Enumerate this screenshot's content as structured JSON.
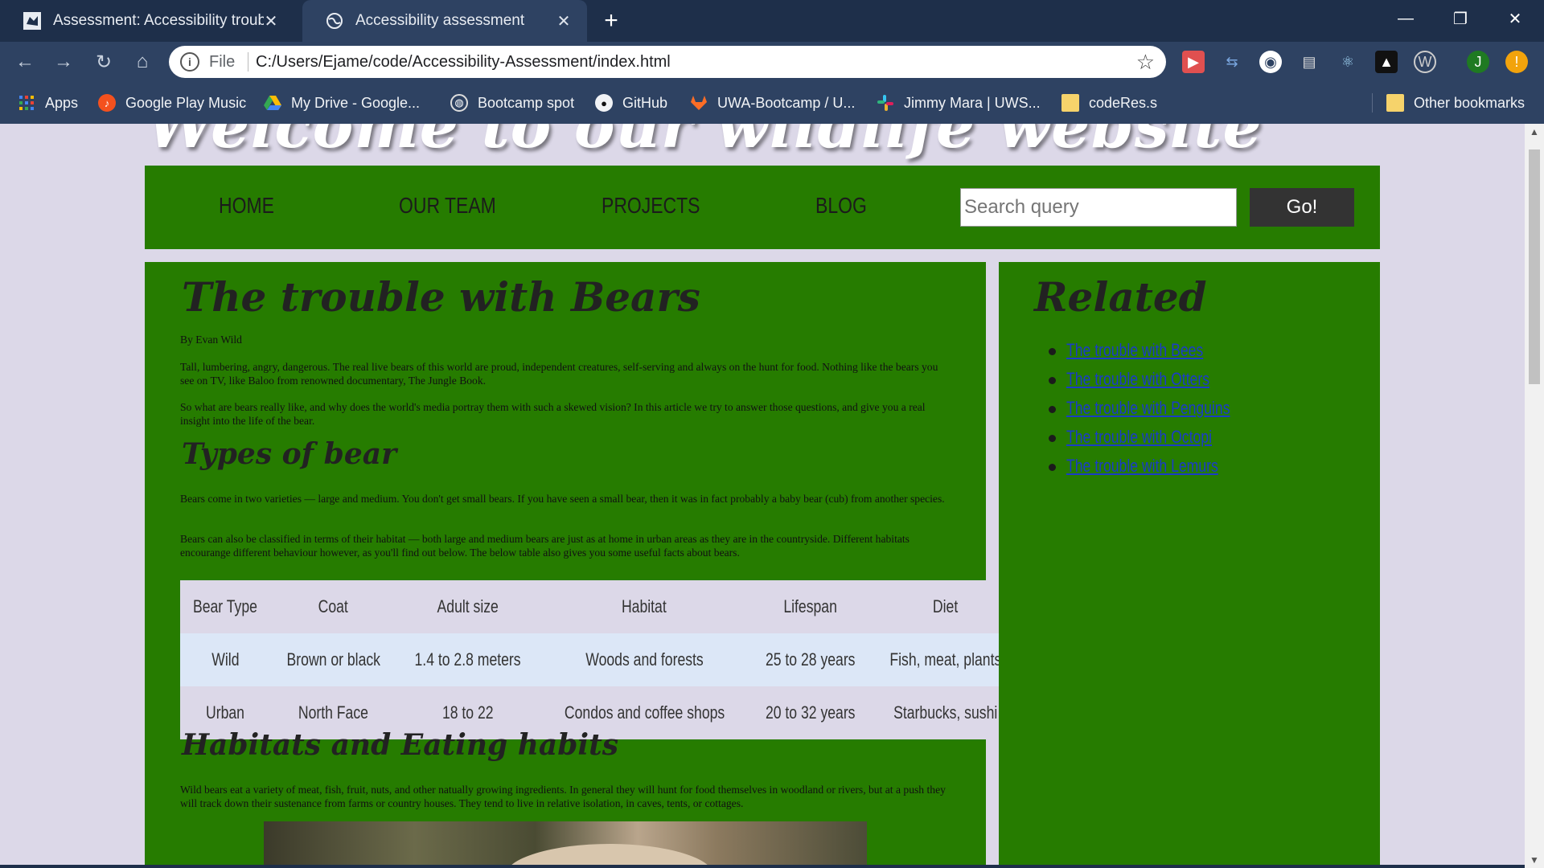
{
  "browser": {
    "tabs": [
      {
        "title": "Assessment: Accessibility troubleshooting"
      },
      {
        "title": "Accessibility assessment"
      }
    ],
    "omnibox": {
      "scheme": "File",
      "url": "C:/Users/Ejame/code/Accessibility-Assessment/index.html"
    },
    "profile_initial": "J",
    "bookmarks": [
      {
        "label": "Apps",
        "icon": "apps-grid-icon"
      },
      {
        "label": "Google Play Music",
        "icon": "play-music-icon"
      },
      {
        "label": "My Drive - Google...",
        "icon": "google-drive-icon"
      },
      {
        "label": "Bootcamp spot",
        "icon": "globe-icon"
      },
      {
        "label": "GitHub",
        "icon": "github-icon"
      },
      {
        "label": "UWA-Bootcamp / U...",
        "icon": "gitlab-icon"
      },
      {
        "label": "Jimmy Mara | UWS...",
        "icon": "slack-icon"
      },
      {
        "label": "codeRes.s",
        "icon": "folder-icon"
      }
    ],
    "other_bookmarks": "Other bookmarks"
  },
  "site": {
    "title": "Welcome to our wildlife website",
    "nav": [
      "HOME",
      "OUR TEAM",
      "PROJECTS",
      "BLOG"
    ],
    "search_placeholder": "Search query",
    "search_button": "Go!"
  },
  "article": {
    "heading": "The trouble with Bears",
    "byline": "By Evan Wild",
    "intro_1": "Tall, lumbering, angry, dangerous. The real live bears of this world are proud, independent creatures, self-serving and always on the hunt for food. Nothing like the bears you see on TV, like Baloo from renowned documentary, The Jungle Book.",
    "intro_2": "So what are bears really like, and why does the world's media portray them with such a skewed vision? In this article we try to answer those questions, and give you a real insight into the life of the bear.",
    "types_heading": "Types of bear",
    "types_1": "Bears come in two varieties — large and medium. You don't get small bears. If you have seen a small bear, then it was in fact probably a baby bear (cub) from another species.",
    "types_2": "Bears can also be classified in terms of their habitat — both large and medium bears are just as at home in urban areas as they are in the countryside. Different habitats encourange different behaviour however, as you'll find out below. The below table also gives you some useful facts about bears.",
    "table": {
      "headers": [
        "Bear Type",
        "Coat",
        "Adult size",
        "Habitat",
        "Lifespan",
        "Diet"
      ],
      "rows": [
        [
          "Wild",
          "Brown or black",
          "1.4 to 2.8 meters",
          "Woods and forests",
          "25 to 28 years",
          "Fish, meat, plants"
        ],
        [
          "Urban",
          "North Face",
          "18 to 22",
          "Condos and coffee shops",
          "20 to 32 years",
          "Starbucks, sushi"
        ]
      ]
    },
    "habitats_heading": "Habitats and Eating habits",
    "habitats_1": "Wild bears eat a variety of meat, fish, fruit, nuts, and other natually growing ingredients. In general they will hunt for food themselves in woodland or rivers, but at a push they will track down their sustenance from farms or country houses. They tend to live in relative isolation, in caves, tents, or cottages."
  },
  "related": {
    "heading": "Related",
    "links": [
      "The trouble with Bees",
      "The trouble with Otters",
      "The trouble with Penguins",
      "The trouble with Octopi",
      "The trouble with Lemurs"
    ]
  }
}
